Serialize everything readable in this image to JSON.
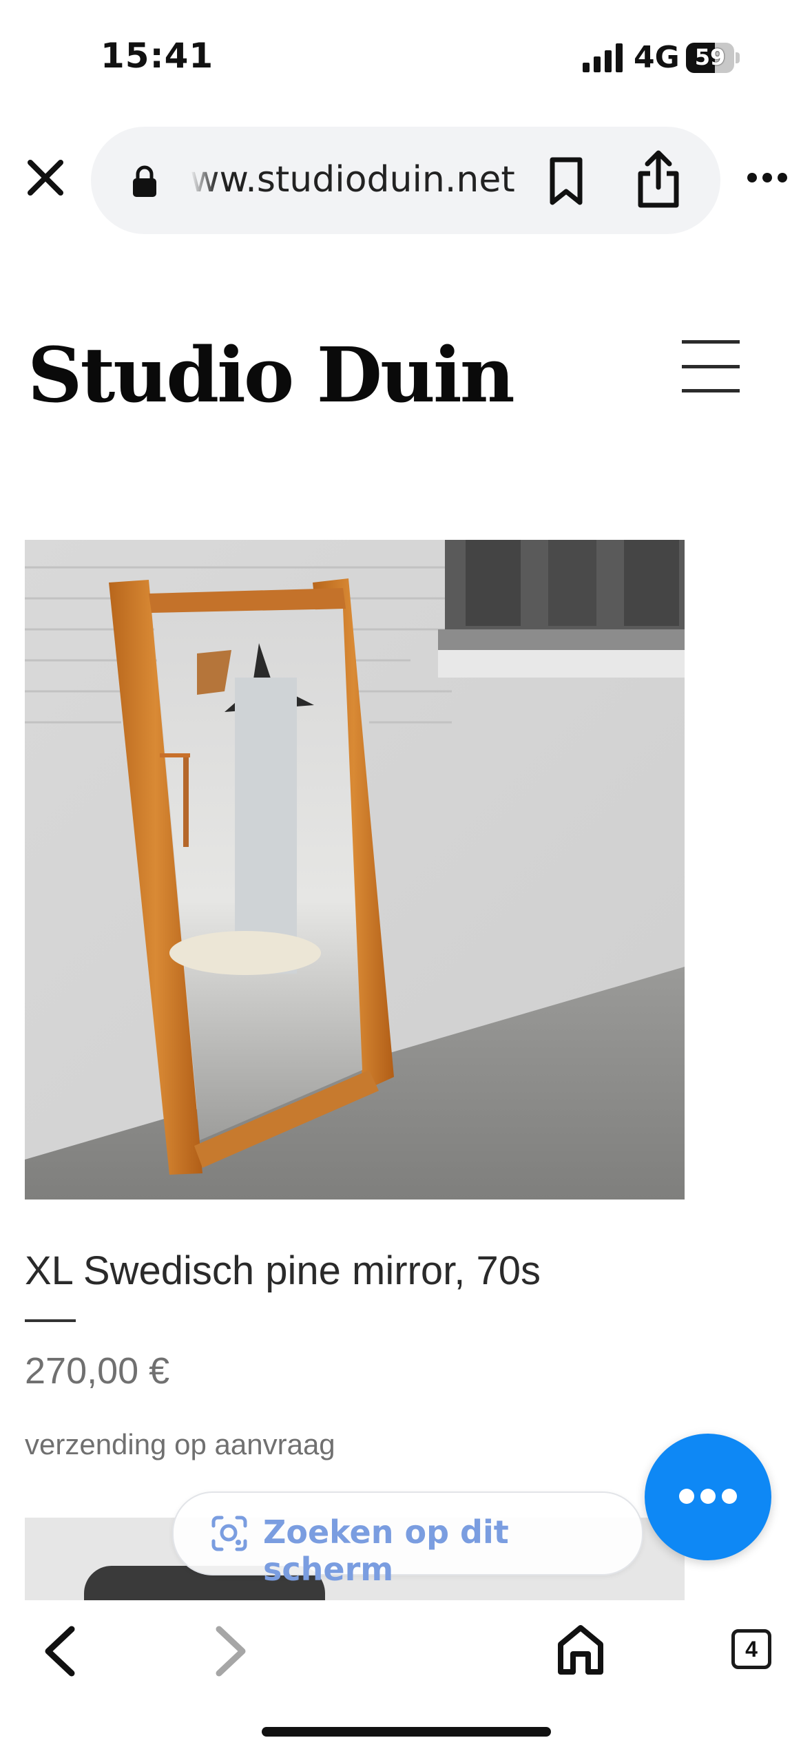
{
  "status_bar": {
    "time": "15:41",
    "network": "4G",
    "battery": "59"
  },
  "browser": {
    "url": "ww.studioduin.net",
    "tabs_count": "4"
  },
  "site": {
    "title": "Studio Duin"
  },
  "product": {
    "title": "XL Swedisch pine mirror, 70s",
    "price": "270,00 €",
    "shipping": "verzending op aanvraag"
  },
  "lens": {
    "label": "Zoeken op dit scherm"
  },
  "colors": {
    "fab": "#0e88f5",
    "lens_text": "#7a9de0",
    "url_bar_bg": "#f2f3f5"
  },
  "icons": [
    "close-icon",
    "lock-icon",
    "bookmark-icon",
    "share-icon",
    "more-icon",
    "menu-icon",
    "chat-icon",
    "lens-icon",
    "back-icon",
    "forward-icon",
    "home-icon",
    "tabs-icon"
  ]
}
